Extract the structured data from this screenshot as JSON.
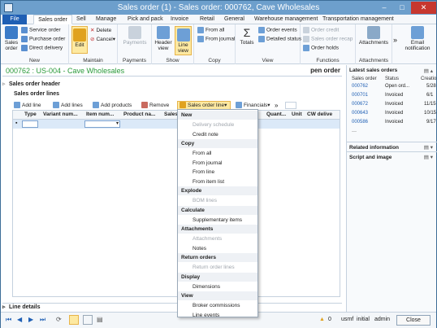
{
  "window": {
    "title": "Sales order (1) - Sales order: 000762, Cave Wholesales",
    "min": "–",
    "max": "□",
    "close": "✕"
  },
  "tabs": [
    "File",
    "Sales order",
    "Sell",
    "Manage",
    "Pick and pack",
    "Invoice",
    "Retail",
    "General",
    "Warehouse management",
    "Transportation management"
  ],
  "ribbon": {
    "new_group": {
      "label": "New",
      "sales_order": "Sales order",
      "service_order": "Service order",
      "purchase_order": "Purchase order",
      "direct_delivery": "Direct delivery"
    },
    "maintain_group": {
      "label": "Maintain",
      "edit": "Edit",
      "delete": "Delete",
      "cancel": "Cancel"
    },
    "payments_group": {
      "label": "Payments",
      "payments": "Payments"
    },
    "show_group": {
      "label": "Show",
      "header_view": "Header view",
      "line_view": "Line view"
    },
    "copy_group": {
      "label": "Copy",
      "from_all": "From all",
      "from_journal": "From journal"
    },
    "view_group": {
      "label": "View",
      "totals": "Totals",
      "order_events": "Order events",
      "detailed_status": "Detailed status"
    },
    "functions_group": {
      "label": "Functions",
      "order_credit": "Order credit",
      "sales_order_recap": "Sales order recap",
      "order_holds": "Order holds"
    },
    "attachments_group": {
      "label": "Attachments",
      "attachments": "Attachments"
    },
    "more": "»",
    "email": "Email notification"
  },
  "form": {
    "title": "000762 : US-004 - Cave Wholesales",
    "right_label": "pen order",
    "header_section": "Sales order header",
    "lines_section": "Sales order lines",
    "line_details": "Line details"
  },
  "lines_toolbar": {
    "add_line": "Add line",
    "add_lines": "Add lines",
    "add_products": "Add products",
    "remove": "Remove",
    "sales_order_line": "Sales order line",
    "financials": "Financials",
    "more": "»"
  },
  "grid": {
    "columns": [
      "",
      "Type",
      "Variant num...",
      "Item num...",
      "Product na...",
      "Sales",
      "Quant...",
      "Unit",
      "CW delive"
    ]
  },
  "menu": {
    "sections": [
      {
        "title": "New",
        "items": [
          {
            "label": "Delivery schedule",
            "enabled": false
          },
          {
            "label": "Credit note",
            "enabled": true
          }
        ]
      },
      {
        "title": "Copy",
        "items": [
          {
            "label": "From all",
            "enabled": true
          },
          {
            "label": "From journal",
            "enabled": true
          },
          {
            "label": "From line",
            "enabled": true
          },
          {
            "label": "From item list",
            "enabled": true
          }
        ]
      },
      {
        "title": "Explode",
        "items": [
          {
            "label": "BOM lines",
            "enabled": false
          }
        ]
      },
      {
        "title": "Calculate",
        "items": [
          {
            "label": "Supplementary items",
            "enabled": true
          }
        ]
      },
      {
        "title": "Attachments",
        "items": [
          {
            "label": "Attachments",
            "enabled": false
          },
          {
            "label": "Notes",
            "enabled": true
          }
        ]
      },
      {
        "title": "Return orders",
        "items": [
          {
            "label": "Return order lines",
            "enabled": false
          }
        ]
      },
      {
        "title": "Display",
        "items": [
          {
            "label": "Dimensions",
            "enabled": true
          }
        ]
      },
      {
        "title": "View",
        "items": [
          {
            "label": "Broker commissions",
            "enabled": true
          },
          {
            "label": "Line events",
            "enabled": true
          }
        ]
      }
    ]
  },
  "factbox": {
    "latest_title": "Latest sales orders",
    "columns": [
      "Sales order",
      "Status",
      "Creatio"
    ],
    "rows": [
      [
        "000762",
        "Open ord...",
        "5/28"
      ],
      [
        "000701",
        "Invoiced",
        "6/1"
      ],
      [
        "000672",
        "Invoiced",
        "11/15"
      ],
      [
        "000643",
        "Invoiced",
        "10/15"
      ],
      [
        "000586",
        "Invoiced",
        "9/17"
      ]
    ],
    "ellipsis": "---",
    "related_title": "Related information",
    "script_title": "Script and image"
  },
  "status": {
    "counter": "0",
    "company": "usmf",
    "user": "initial",
    "role": "admin",
    "close": "Close"
  },
  "colors": {
    "accent": "#1f5fb4",
    "title": "#2a9a3a",
    "selected": "#fde9a1"
  }
}
